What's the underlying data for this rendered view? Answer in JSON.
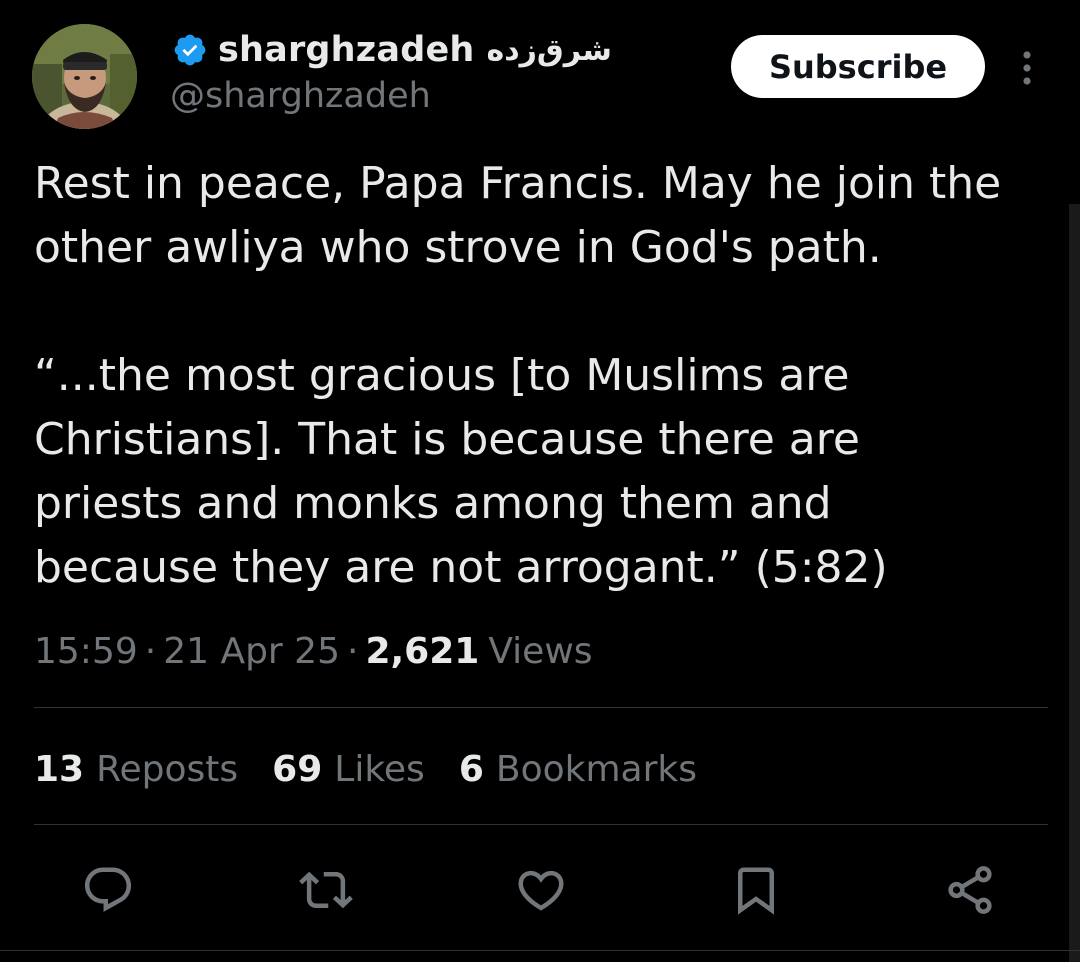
{
  "author": {
    "display_name": "sharghzadeh",
    "display_name_persian": "شرق‌زده",
    "handle": "@sharghzadeh",
    "verified": true
  },
  "header": {
    "subscribe_label": "Subscribe"
  },
  "tweet": {
    "lines": [
      "Rest in peace, Papa Francis. May he join the",
      "other awliya who strove in God's path."
    ],
    "quote_lines": [
      "“...the most gracious [to Muslims are",
      "Christians]. That is because there are",
      "priests and monks among them and",
      "because they are not arrogant.” (5:82)"
    ]
  },
  "meta": {
    "time": "15:59",
    "separator": "·",
    "date": "21 Apr 25",
    "views_count": "2,621",
    "views_label": "Views"
  },
  "stats": [
    {
      "count": "13",
      "label": "Reposts"
    },
    {
      "count": "69",
      "label": "Likes"
    },
    {
      "count": "6",
      "label": "Bookmarks"
    }
  ],
  "actions": [
    {
      "icon": "reply-icon"
    },
    {
      "icon": "repost-icon"
    },
    {
      "icon": "like-icon"
    },
    {
      "icon": "bookmark-icon"
    },
    {
      "icon": "share-icon"
    }
  ],
  "colors": {
    "background": "#000000",
    "text_primary": "#e7e9ea",
    "text_secondary": "#71767b",
    "verified_blue": "#1d9bf0",
    "divider": "#2f3336",
    "subscribe_bg": "#ffffff"
  }
}
